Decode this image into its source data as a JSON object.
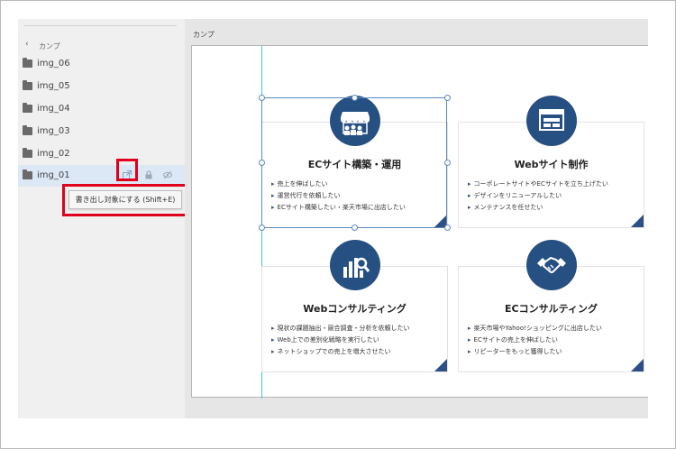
{
  "sidebar": {
    "back_label": "カンプ",
    "layers": [
      {
        "name": "img_06"
      },
      {
        "name": "img_05"
      },
      {
        "name": "img_04"
      },
      {
        "name": "img_03"
      },
      {
        "name": "img_02"
      },
      {
        "name": "img_01"
      }
    ],
    "tooltip": "書き出し対象にする (Shift+E)"
  },
  "main": {
    "title": "カンプ",
    "cards": [
      {
        "title": "ECサイト構築・運用",
        "icon": "storefront-icon",
        "bullets": [
          "売上を伸ばしたい",
          "運営代行を依頼したい",
          "ECサイト構築したい・楽天市場に出店したい"
        ]
      },
      {
        "title": "Webサイト制作",
        "icon": "browser-window-icon",
        "bullets": [
          "コーポレートサイトやECサイトを立ち上げたい",
          "デザインをリニューアルしたい",
          "メンテナンスを任せたい"
        ]
      },
      {
        "title": "Webコンサルティング",
        "icon": "chart-magnifier-icon",
        "bullets": [
          "現状の課題抽出・競合調査・分析を依頼したい",
          "Web上での差別化戦略を実行したい",
          "ネットショップでの売上を増大させたい"
        ]
      },
      {
        "title": "ECコンサルティング",
        "icon": "handshake-icon",
        "bullets": [
          "楽天市場やYahoo!ショッピングに出店したい",
          "ECサイトの売上を伸ばしたい",
          "リピーターをもっと獲得したい"
        ]
      }
    ]
  },
  "colors": {
    "accent": "#264f82",
    "highlight": "#e0001b",
    "guide": "#46c3d1",
    "selection_row": "#dce8f6"
  }
}
